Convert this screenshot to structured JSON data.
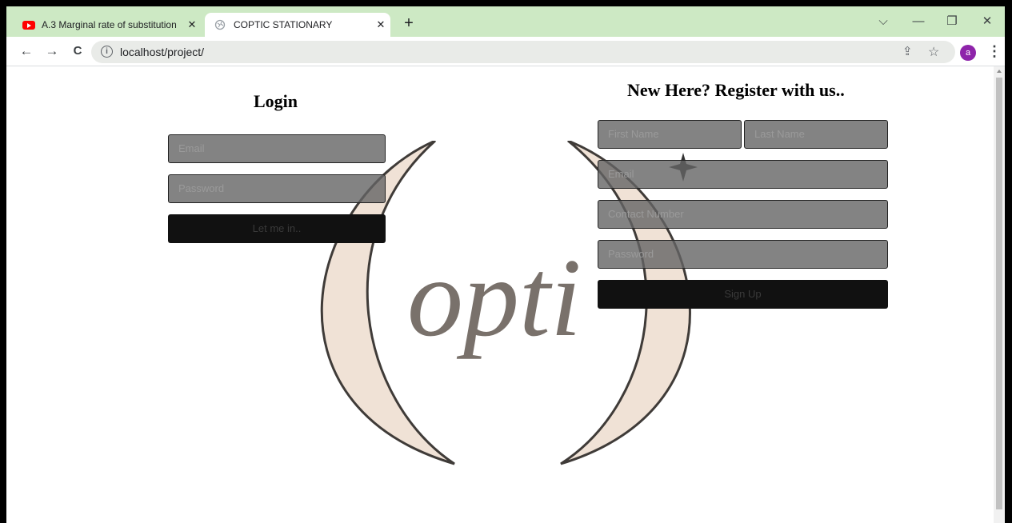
{
  "browser": {
    "tabs": [
      {
        "title": "A.3 Marginal rate of substitution",
        "close": "✕"
      },
      {
        "title": "COPTIC STATIONARY",
        "close": "✕"
      }
    ],
    "new_tab": "+",
    "window_controls": {
      "dropdown": "⌵",
      "minimize": "—",
      "restore": "❐",
      "close": "✕"
    },
    "nav": {
      "back": "←",
      "forward": "→",
      "reload": "C"
    },
    "url": "localhost/project/",
    "share_icon": "⇪",
    "bookmark_icon": "☆",
    "avatar_letter": "a",
    "menu": "⋮"
  },
  "page": {
    "login": {
      "heading": "Login",
      "email_placeholder": "Email",
      "password_placeholder": "Password",
      "submit_label": "Let me in.."
    },
    "register": {
      "heading": "New Here? Register with us..",
      "first_name_placeholder": "First Name",
      "last_name_placeholder": "Last Name",
      "email_placeholder": "Email",
      "contact_placeholder": "Contact Number",
      "password_placeholder": "Password",
      "submit_label": "Sign Up"
    },
    "logo_text": "opti"
  },
  "colors": {
    "tabstrip": "#cde9c4",
    "field_bg": "#646464",
    "button_bg": "#111111",
    "logo_fill": "#f0e2d6",
    "logo_stroke": "#3f3b38"
  }
}
